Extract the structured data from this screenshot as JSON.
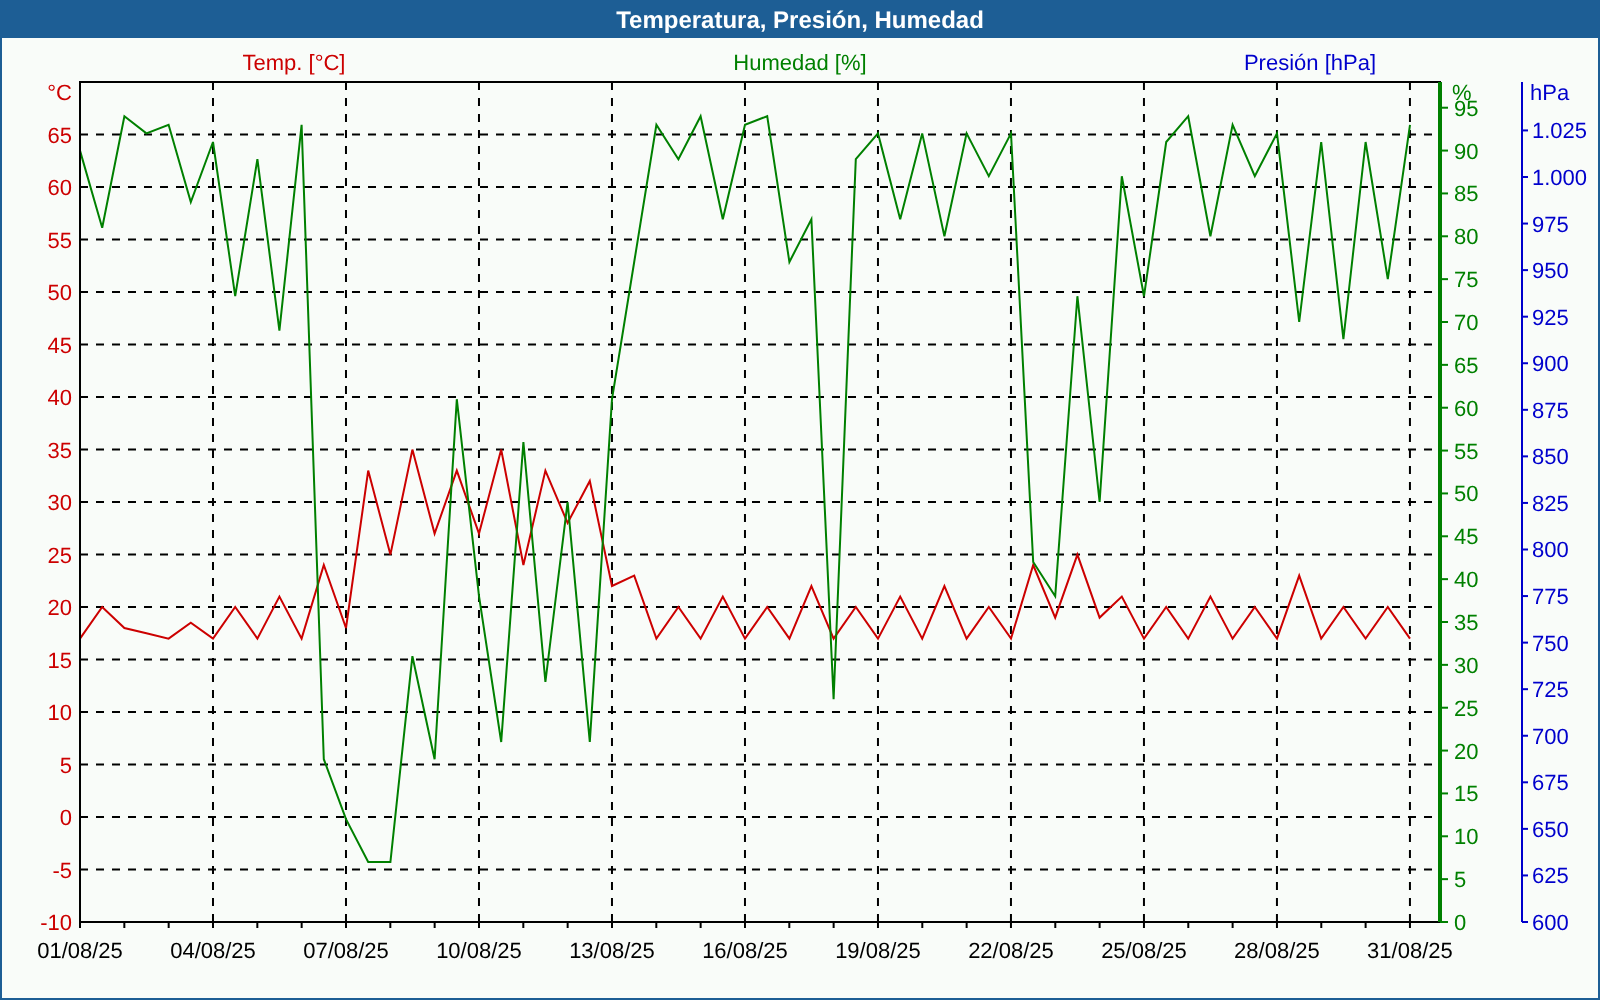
{
  "window": {
    "title": "Temperatura, Presión, Humedad"
  },
  "chart": {
    "chart_data": {
      "type": "line",
      "grid": true,
      "ylabel": "°C",
      "ylim": [
        -10,
        70
      ],
      "y2label": "%",
      "y2lim": [
        0,
        98
      ],
      "y2ticks": [
        0,
        5,
        10,
        15,
        20,
        25,
        30,
        35,
        40,
        45,
        50,
        55,
        60,
        65,
        70,
        75,
        80,
        85,
        90,
        95
      ],
      "y3label": "hPa",
      "y3lim": [
        600,
        1051
      ],
      "y3ticks": [
        600,
        625,
        650,
        675,
        700,
        725,
        750,
        775,
        800,
        825,
        850,
        875,
        900,
        925,
        950,
        975,
        {
          "value": 1000,
          "label": "1.000"
        },
        {
          "value": 1025,
          "label": "1.025"
        }
      ],
      "categories": [
        "01/08/25",
        null,
        null,
        null,
        null,
        null,
        "04/08/25",
        null,
        null,
        null,
        null,
        null,
        "07/08/25",
        null,
        null,
        null,
        null,
        null,
        "10/08/25",
        null,
        null,
        null,
        null,
        null,
        "13/08/25",
        null,
        null,
        null,
        null,
        null,
        "16/08/25",
        null,
        null,
        null,
        null,
        null,
        "19/08/25",
        null,
        null,
        null,
        null,
        null,
        "22/08/25",
        null,
        null,
        null,
        null,
        null,
        "25/08/25",
        null,
        null,
        null,
        null,
        null,
        "28/08/25",
        null,
        null,
        null,
        null,
        null,
        "31/08/25"
      ],
      "yticks": [
        -10,
        -5,
        0,
        5,
        10,
        15,
        20,
        25,
        30,
        35,
        40,
        45,
        50,
        55,
        60,
        65
      ],
      "series": [
        {
          "name": "Temp. [°C]",
          "color": "#cc0000",
          "values": [
            17,
            20,
            18,
            17.5,
            17,
            18.5,
            17,
            20,
            17,
            21,
            17,
            24,
            18,
            33,
            25,
            35,
            27,
            33,
            27,
            35,
            24,
            33,
            28,
            32,
            22,
            23,
            17,
            20,
            17,
            21,
            17,
            20,
            17,
            22,
            17,
            20,
            17,
            21,
            17,
            22,
            17,
            20,
            17,
            24,
            19,
            25,
            19,
            21,
            17,
            20,
            17,
            21,
            17,
            20,
            17,
            23,
            17,
            20,
            17,
            20,
            17
          ]
        },
        {
          "name": "Humedad [%]",
          "color": "#008000",
          "axis": "y2",
          "values": [
            90,
            81,
            94,
            92,
            93,
            84,
            91,
            73,
            89,
            69,
            93,
            19,
            12,
            7,
            7,
            31,
            19,
            61,
            38,
            21,
            56,
            28,
            49,
            21,
            61,
            77,
            93,
            89,
            94,
            82,
            93,
            94,
            77,
            82,
            26,
            89,
            92,
            82,
            92,
            80,
            92,
            87,
            92,
            42,
            38,
            73,
            49,
            87,
            73,
            91,
            94,
            80,
            93,
            87,
            92,
            70,
            91,
            68,
            91,
            75,
            93
          ]
        }
      ]
    },
    "pressure_axis": {
      "legend": "Presión [hPa]",
      "color": "#0000cc"
    }
  }
}
